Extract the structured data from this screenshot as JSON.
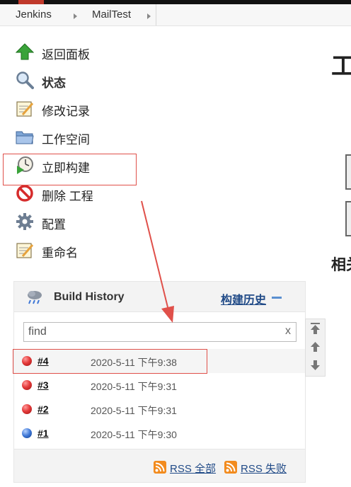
{
  "breadcrumbs": [
    "Jenkins",
    "MailTest"
  ],
  "sidebar": {
    "items": [
      {
        "label": "返回面板",
        "icon": "up-arrow-icon"
      },
      {
        "label": "状态",
        "icon": "magnifier-icon"
      },
      {
        "label": "修改记录",
        "icon": "notepad-icon"
      },
      {
        "label": "工作空间",
        "icon": "folder-icon"
      },
      {
        "label": "立即构建",
        "icon": "build-clock-icon"
      },
      {
        "label": "删除 工程",
        "icon": "no-entry-icon"
      },
      {
        "label": "配置",
        "icon": "gear-icon"
      },
      {
        "label": "重命名",
        "icon": "notepad-icon"
      }
    ]
  },
  "build_history": {
    "title": "Build History",
    "trend_link": "构建历史",
    "search_placeholder": "find",
    "search_clear": "x",
    "builds": [
      {
        "number": "#4",
        "time": "2020-5-11 下午9:38",
        "status": "failed"
      },
      {
        "number": "#3",
        "time": "2020-5-11 下午9:31",
        "status": "failed"
      },
      {
        "number": "#2",
        "time": "2020-5-11 下午9:31",
        "status": "failed"
      },
      {
        "number": "#1",
        "time": "2020-5-11 下午9:30",
        "status": "success"
      }
    ],
    "rss_all": "RSS 全部",
    "rss_failed": "RSS 失败"
  },
  "main": {
    "heading_fragment": "工",
    "subheading_fragment": "相关"
  },
  "colors": {
    "accent_link": "#204a87",
    "annotation_red": "#e0504a",
    "failed_ball": "#e53b3b",
    "success_ball": "#3e77d6",
    "rss_orange": "#f28b1e"
  }
}
